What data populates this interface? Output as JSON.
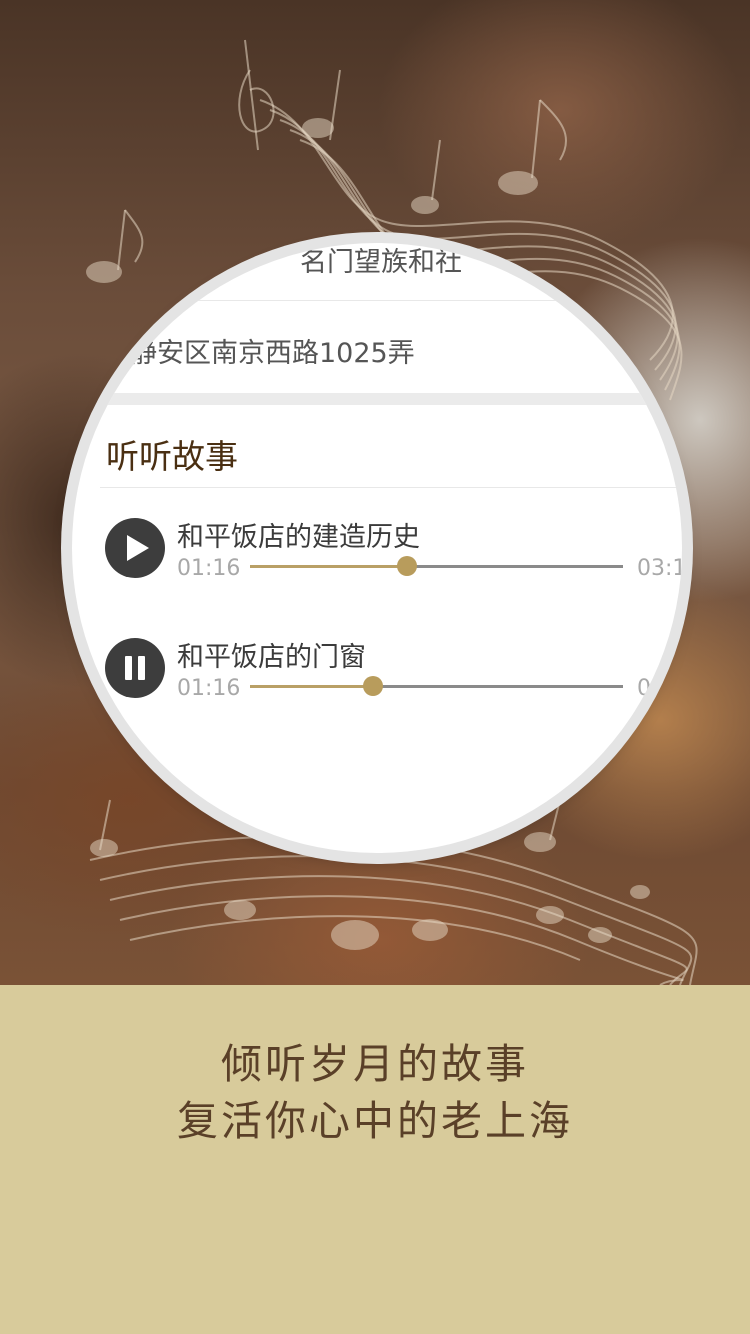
{
  "magnifier": {
    "partial_line": "名门望族和社",
    "address": "静安区南京西路1025弄",
    "section_title": "听听故事",
    "tracks": [
      {
        "title": "和平饭店的建造历史",
        "current_time": "01:16",
        "total_time": "03:1",
        "state": "paused",
        "control_icon": "play-icon",
        "progress": 0.42
      },
      {
        "title": "和平饭店的门窗",
        "current_time": "01:16",
        "total_time": "0",
        "state": "playing",
        "control_icon": "pause-icon",
        "progress": 0.33
      }
    ]
  },
  "tagline": {
    "line1": "倾听岁月的故事",
    "line2": "复活你心中的老上海"
  },
  "colors": {
    "accent": "#b89c5c",
    "bottom_panel": "#d8cb9b",
    "tagline_text": "#5a4028",
    "section_title": "#4a2f12",
    "control_bg": "#3d3d3d"
  },
  "decoration": "music-notes"
}
